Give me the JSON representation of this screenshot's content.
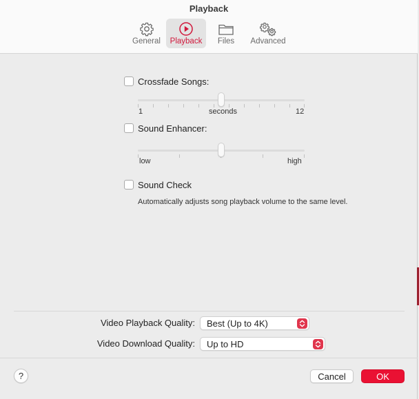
{
  "window": {
    "title": "Playback"
  },
  "toolbar": {
    "tabs": [
      {
        "label": "General",
        "icon": "gear-icon",
        "selected": false
      },
      {
        "label": "Playback",
        "icon": "play-circle-icon",
        "selected": true
      },
      {
        "label": "Files",
        "icon": "folder-icon",
        "selected": false
      },
      {
        "label": "Advanced",
        "icon": "gears-icon",
        "selected": false
      }
    ]
  },
  "crossfade": {
    "label": "Crossfade Songs:",
    "checked": false,
    "min_label": "1",
    "mid_label": "seconds",
    "max_label": "12",
    "value_fraction": 0.5
  },
  "sound_enhancer": {
    "label": "Sound Enhancer:",
    "checked": false,
    "min_label": "low",
    "max_label": "high",
    "value_fraction": 0.5
  },
  "sound_check": {
    "label": "Sound Check",
    "checked": false,
    "description": "Automatically adjusts song playback volume to the same level."
  },
  "video_playback_quality": {
    "label": "Video Playback Quality:",
    "selected": "Best (Up to 4K)"
  },
  "video_download_quality": {
    "label": "Video Download Quality:",
    "selected": "Up to HD"
  },
  "footer": {
    "help_label": "?",
    "cancel_label": "Cancel",
    "ok_label": "OK"
  },
  "colors": {
    "accent": "#ea1133",
    "selected_tab_text": "#d1173b"
  }
}
